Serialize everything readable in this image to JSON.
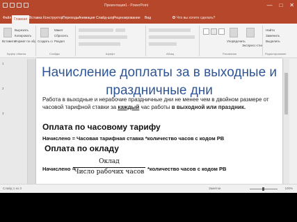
{
  "window": {
    "title": "Презентация1 - PowerPoint",
    "controls": {
      "minimize": "—",
      "maximize": "□",
      "close": "✕"
    }
  },
  "ribbon_tabs": [
    "Файл",
    "Главная",
    "Вставка",
    "Конструктор",
    "Переходы",
    "Анимация",
    "Слайд-шоу",
    "Рецензирование",
    "Вид"
  ],
  "tell_me": "Что вы хотите сделать?",
  "ribbon": {
    "clipboard": {
      "paste": "Вставить",
      "cut": "Вырезать",
      "copy": "Копировать",
      "format": "Формат по образцу",
      "group": "Буфер обмена"
    },
    "slides": {
      "new_slide": "Создать слайд",
      "layout": "Макет",
      "reset": "Сбросить",
      "section": "Раздел",
      "group": "Слайды"
    },
    "font": {
      "group": "Шрифт"
    },
    "paragraph": {
      "group": "Абзац"
    },
    "drawing": {
      "arrange": "Упорядочить",
      "styles": "Экспресс-стили",
      "group": "Рисование"
    },
    "editing": {
      "find": "Найти",
      "replace": "Заменить",
      "select": "Выделить",
      "group": "Редактирование"
    }
  },
  "thumbnails": [
    "1",
    "2",
    "3"
  ],
  "slide": {
    "title": "Начисление доплаты за в выходные и праздничные дни",
    "intro_before": "Работа в выходные и нерабочие праздничные дни не менее чем в двойном размере от часовой тарифной ставки за ",
    "intro_emphasis": "каждый",
    "intro_middle": " час работы ",
    "intro_bold": "в выходной или праздник.",
    "heading_hourly": "Оплата по часовому тарифу",
    "formula_hourly": "Начислено = Часовая тарифная ставка *количество часов с кодом РВ",
    "heading_salary": "Оплата по окладу",
    "formula_salary_label": "Начислено =",
    "fraction_numerator": "Оклад",
    "fraction_denominator": "Число рабочих часов",
    "formula_salary_tail": "*количество часов с кодом РВ"
  },
  "status": {
    "left": "Слайд 1 из 3",
    "notes": "Заметки",
    "zoom": "100%"
  },
  "colors": {
    "accent": "#b7472a",
    "title": "#2f5597"
  }
}
